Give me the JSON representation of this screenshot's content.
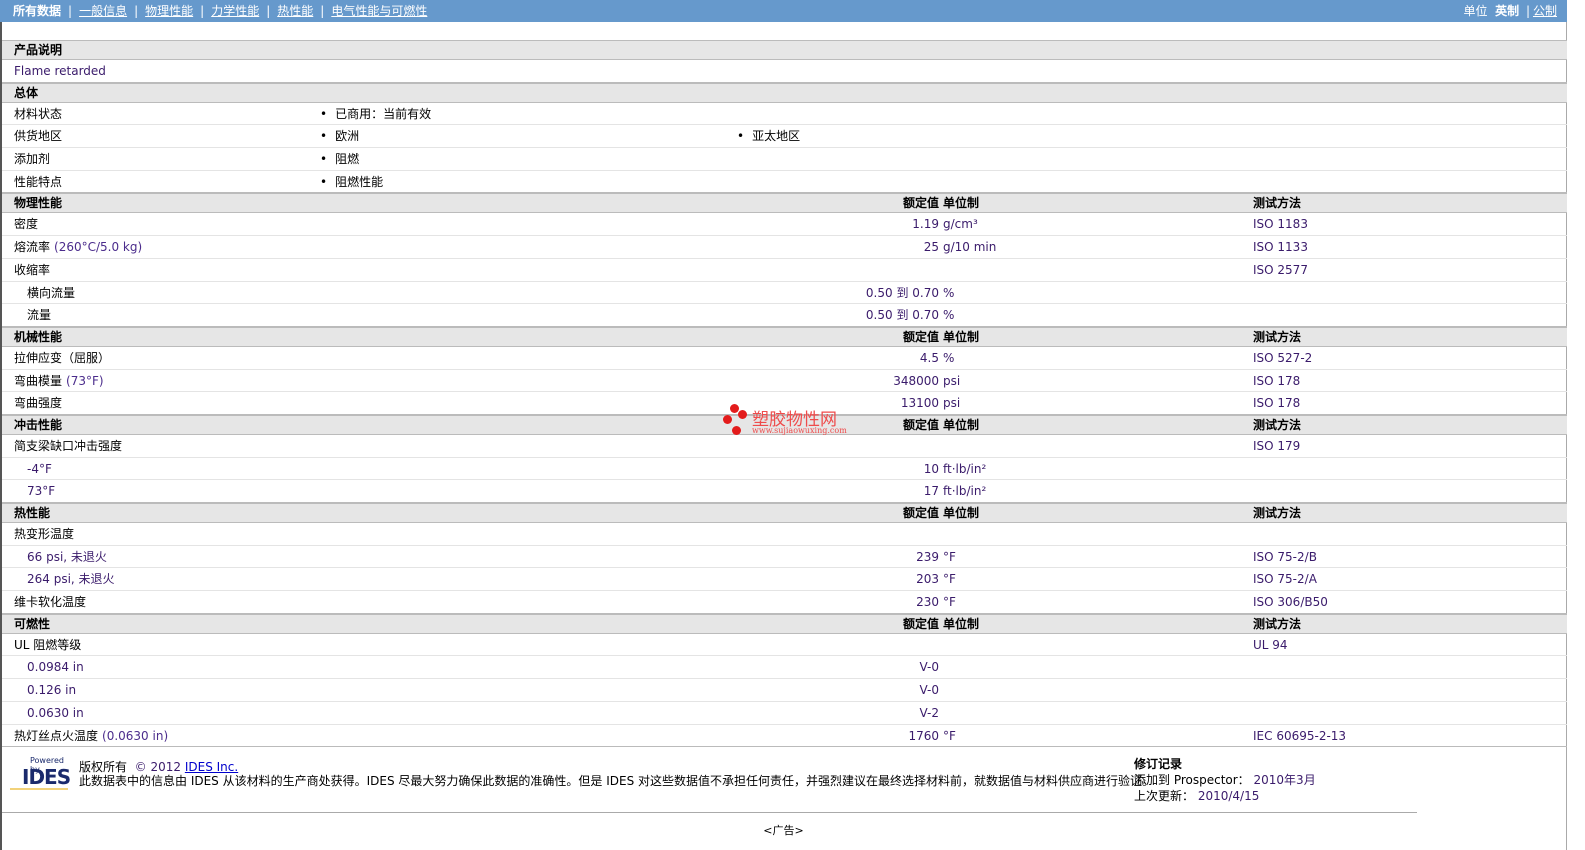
{
  "nav": {
    "items": [
      "所有数据",
      "一般信息",
      "物理性能",
      "力学性能",
      "热性能",
      "电气性能与可燃性"
    ],
    "units_label": "单位",
    "unit_english": "英制",
    "unit_metric": "公制"
  },
  "headers": {
    "value": "额定值",
    "unit": "单位制",
    "test": "测试方法"
  },
  "sections": [
    {
      "title": "产品说明",
      "type": "text",
      "rows": [
        {
          "label": "Flame retarded"
        }
      ]
    },
    {
      "title": "总体",
      "type": "general",
      "rows": [
        {
          "label": "材料状态",
          "items": [
            "已商用：当前有效"
          ]
        },
        {
          "label": "供货地区",
          "items": [
            "欧洲",
            "亚太地区"
          ]
        },
        {
          "label": "添加剂",
          "items": [
            "阻燃"
          ]
        },
        {
          "label": "性能特点",
          "items": [
            "阻燃性能"
          ]
        }
      ]
    },
    {
      "title": "物理性能",
      "type": "props",
      "rows": [
        {
          "label": "密度",
          "value": "1.19",
          "unit": "g/cm³",
          "test": "ISO 1183"
        },
        {
          "label": "熔流率",
          "cond": "(260°C/5.0 kg)",
          "value": "25",
          "unit": "g/10 min",
          "test": "ISO 1133"
        },
        {
          "label": "收缩率",
          "test": "ISO 2577"
        },
        {
          "label": "横向流量",
          "indent": true,
          "value": "0.50 到  0.70",
          "unit": "%"
        },
        {
          "label": "流量",
          "indent": true,
          "value": "0.50 到  0.70",
          "unit": "%"
        }
      ]
    },
    {
      "title": "机械性能",
      "type": "props",
      "rows": [
        {
          "label": "拉伸应变（屈服）",
          "value": "4.5",
          "unit": "%",
          "test": "ISO 527-2"
        },
        {
          "label": "弯曲模量",
          "cond": "(73°F)",
          "value": "348000",
          "unit": "psi",
          "test": "ISO 178"
        },
        {
          "label": "弯曲强度",
          "value": "13100",
          "unit": "psi",
          "test": "ISO 178"
        }
      ]
    },
    {
      "title": "冲击性能",
      "type": "props",
      "rows": [
        {
          "label": "简支梁缺口冲击强度",
          "test": "ISO 179"
        },
        {
          "label": "-4°F",
          "indent": true,
          "value": "10",
          "unit": "ft·lb/in²"
        },
        {
          "label": "73°F",
          "indent": true,
          "value": "17",
          "unit": "ft·lb/in²"
        }
      ]
    },
    {
      "title": "热性能",
      "type": "props",
      "rows": [
        {
          "label": "热变形温度"
        },
        {
          "label": "66 psi, 未退火",
          "indent": true,
          "value": "239",
          "unit": "°F",
          "test": "ISO 75-2/B"
        },
        {
          "label": "264 psi, 未退火",
          "indent": true,
          "value": "203",
          "unit": "°F",
          "test": "ISO 75-2/A"
        },
        {
          "label": "维卡软化温度",
          "value": "230",
          "unit": "°F",
          "test": "ISO 306/B50"
        }
      ]
    },
    {
      "title": "可燃性",
      "type": "props",
      "rows": [
        {
          "label": "UL 阻燃等级",
          "test": "UL 94"
        },
        {
          "label": "0.0984 in",
          "indent": true,
          "value": "V-0"
        },
        {
          "label": "0.126 in",
          "indent": true,
          "value": "V-0"
        },
        {
          "label": "0.0630 in",
          "indent": true,
          "value": "V-2"
        },
        {
          "label": "热灯丝点火温度",
          "cond": "(0.0630 in)",
          "value": "1760",
          "unit": "°F",
          "test": "IEC 60695-2-13"
        }
      ]
    }
  ],
  "watermark": {
    "title": "塑胶物性网",
    "url": "www.sujiaowuxing.com"
  },
  "footer": {
    "logo_powered": "Powered by",
    "logo_name": "IDES",
    "copyright": "版权所有",
    "year": "© 2012",
    "company_link": "IDES Inc.",
    "disclaimer": "此数据表中的信息由 IDES 从该材料的生产商处获得。IDES 尽最大努力确保此数据的准确性。但是 IDES 对这些数据值不承担任何责任，并强烈建议在最终选择材料前，就数据值与材料供应商进行验证。",
    "revision_title": "修订记录",
    "added_label": "添加到 Prospector：",
    "added_value": "2010年3月",
    "updated_label": "上次更新：",
    "updated_value": "2010/4/15",
    "ad": "<广告>"
  }
}
